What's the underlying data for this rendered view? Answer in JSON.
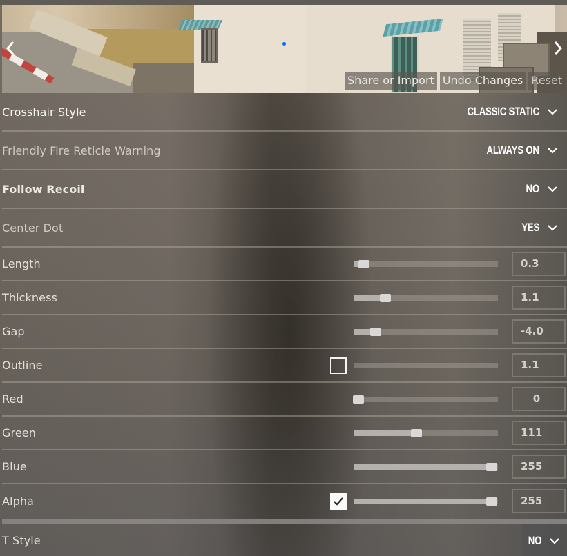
{
  "preview": {
    "prev_label": "previous-preview",
    "next_label": "next-preview",
    "crosshair_color": "#006fff",
    "actions": {
      "share_import": "Share or Import",
      "undo_changes": "Undo Changes",
      "reset": "Reset"
    }
  },
  "settings": {
    "dropdowns": [
      {
        "label": "Crosshair Style",
        "value": "CLASSIC STATIC"
      },
      {
        "label": "Friendly Fire Reticle Warning",
        "value": "ALWAYS ON"
      },
      {
        "label": "Follow Recoil",
        "value": "NO"
      },
      {
        "label": "Center Dot",
        "value": "YES"
      }
    ],
    "sliders": [
      {
        "label": "Length",
        "value": "0.3",
        "fraction": 0.04,
        "has_checkbox": false
      },
      {
        "label": "Thickness",
        "value": "1.1",
        "fraction": 0.2,
        "has_checkbox": false
      },
      {
        "label": "Gap",
        "value": "-4.0",
        "fraction": 0.13,
        "has_checkbox": false
      },
      {
        "label": "Outline",
        "value": "1.1",
        "fraction": 0.0,
        "has_checkbox": true,
        "checked": false,
        "thumb": false
      },
      {
        "label": "Red",
        "value": "0",
        "fraction": 0.0,
        "has_checkbox": false
      },
      {
        "label": "Green",
        "value": "111",
        "fraction": 0.435,
        "has_checkbox": false
      },
      {
        "label": "Blue",
        "value": "255",
        "fraction": 1.0,
        "has_checkbox": false
      },
      {
        "label": "Alpha",
        "value": "255",
        "fraction": 1.0,
        "has_checkbox": true,
        "checked": true
      }
    ],
    "t_style": {
      "label": "T Style",
      "value": "NO"
    }
  }
}
